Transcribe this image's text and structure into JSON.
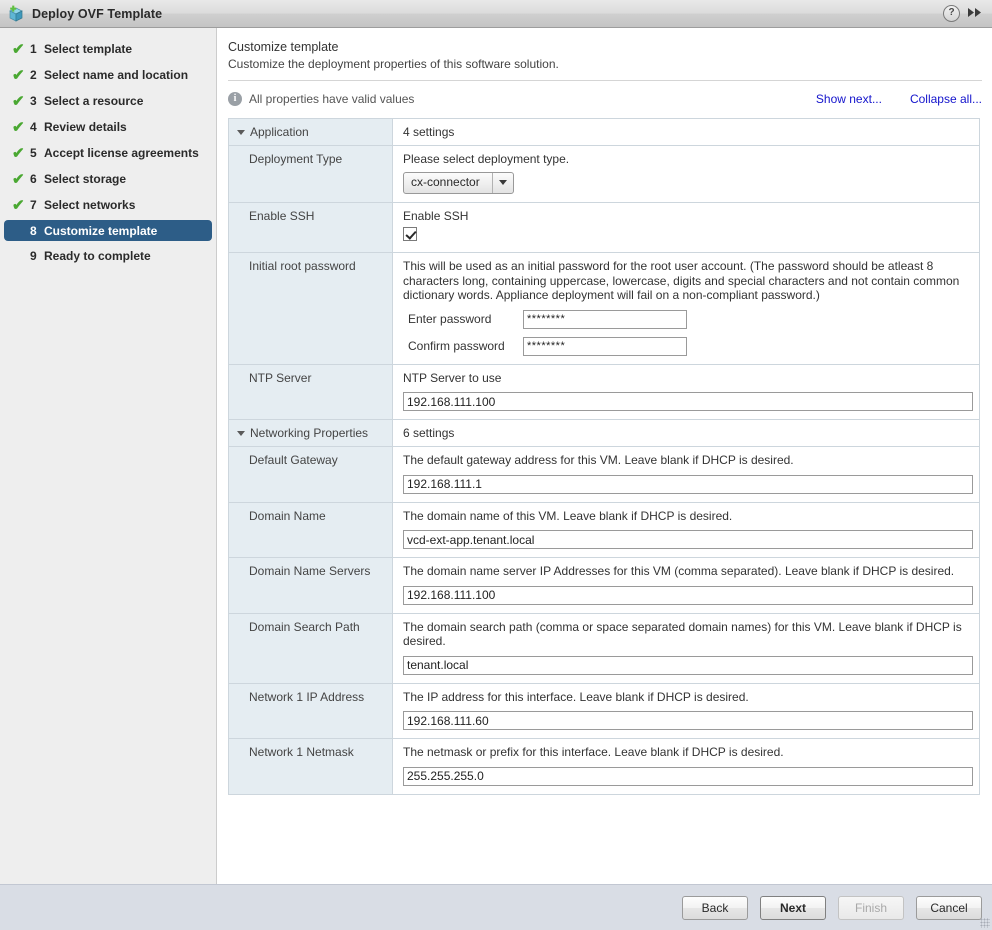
{
  "window": {
    "title": "Deploy OVF Template",
    "icon": "ovf-package-icon",
    "help_label": "?",
    "forward_label": "▸▸"
  },
  "sidebar": {
    "steps": [
      {
        "num": "1",
        "label": "Select template",
        "completed": true,
        "active": false
      },
      {
        "num": "2",
        "label": "Select name and location",
        "completed": true,
        "active": false
      },
      {
        "num": "3",
        "label": "Select a resource",
        "completed": true,
        "active": false
      },
      {
        "num": "4",
        "label": "Review details",
        "completed": true,
        "active": false
      },
      {
        "num": "5",
        "label": "Accept license agreements",
        "completed": true,
        "active": false
      },
      {
        "num": "6",
        "label": "Select storage",
        "completed": true,
        "active": false
      },
      {
        "num": "7",
        "label": "Select networks",
        "completed": true,
        "active": false
      },
      {
        "num": "8",
        "label": "Customize template",
        "completed": false,
        "active": true
      },
      {
        "num": "9",
        "label": "Ready to complete",
        "completed": false,
        "active": false
      }
    ],
    "check_glyph": "✔"
  },
  "main": {
    "title": "Customize template",
    "subtitle": "Customize the deployment properties of this software solution.",
    "status_text": "All properties have valid values",
    "info_glyph": "i",
    "show_next_link": "Show next...",
    "collapse_all_link": "Collapse all..."
  },
  "properties": {
    "sections": [
      {
        "name": "Application",
        "settings_count": "4 settings",
        "rows": [
          {
            "label": "Deployment Type",
            "description": "Please select deployment type.",
            "control": "dropdown",
            "value": "cx-connector"
          },
          {
            "label": "Enable SSH",
            "description": "Enable SSH",
            "control": "checkbox",
            "checked": true
          },
          {
            "label": "Initial root password",
            "description": "This will be used as an initial password for the root user account. (The password should be atleast 8 characters long, containing uppercase, lowercase, digits and special characters and not contain common dictionary words. Appliance deployment will fail on a non-compliant password.)",
            "control": "password-pair",
            "fields": [
              {
                "label": "Enter password",
                "value": "********"
              },
              {
                "label": "Confirm password",
                "value": "********"
              }
            ]
          },
          {
            "label": "NTP Server",
            "description": "NTP Server to use",
            "control": "text",
            "value": "192.168.111.100"
          }
        ]
      },
      {
        "name": "Networking Properties",
        "settings_count": "6 settings",
        "rows": [
          {
            "label": "Default Gateway",
            "description": "The default gateway address for this VM. Leave blank if DHCP is desired.",
            "control": "text",
            "value": "192.168.111.1"
          },
          {
            "label": "Domain Name",
            "description": "The domain name of this VM. Leave blank if DHCP is desired.",
            "control": "text",
            "value": "vcd-ext-app.tenant.local"
          },
          {
            "label": "Domain Name Servers",
            "description": "The domain name server IP Addresses for this VM (comma separated). Leave blank if DHCP is desired.",
            "control": "text",
            "value": "192.168.111.100"
          },
          {
            "label": "Domain Search Path",
            "description": "The domain search path (comma or space separated domain names) for this VM. Leave blank if DHCP is desired.",
            "control": "text",
            "value": "tenant.local"
          },
          {
            "label": "Network 1 IP Address",
            "description": "The IP address for this interface. Leave blank if DHCP is desired.",
            "control": "text",
            "value": "192.168.111.60"
          },
          {
            "label": "Network 1 Netmask",
            "description": "The netmask or prefix for this interface. Leave blank if DHCP is desired.",
            "control": "text",
            "value": "255.255.255.0"
          }
        ]
      }
    ]
  },
  "footer": {
    "back_label": "Back",
    "next_label": "Next",
    "finish_label": "Finish",
    "cancel_label": "Cancel"
  },
  "colors": {
    "accent": "#2d5d87",
    "link": "#1414cc",
    "check": "#4aa832",
    "label_bg": "#e5edf2",
    "footer_bg": "#d9dde5",
    "sidebar_bg": "#eeeeee"
  }
}
